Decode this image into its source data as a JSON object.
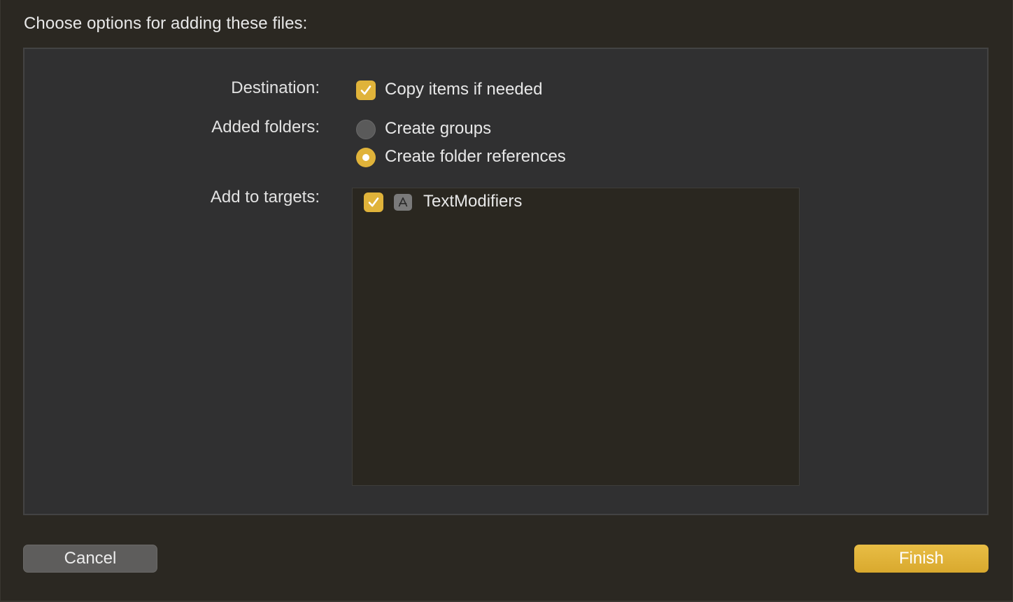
{
  "dialog": {
    "heading": "Choose options for adding these files:"
  },
  "options": {
    "destination": {
      "label": "Destination:",
      "checkbox_label": "Copy items if needed",
      "checked": true
    },
    "added_folders": {
      "label": "Added folders:",
      "choices": [
        {
          "label": "Create groups",
          "selected": false
        },
        {
          "label": "Create folder references",
          "selected": true
        }
      ]
    },
    "targets": {
      "label": "Add to targets:",
      "items": [
        {
          "name": "TextModifiers",
          "checked": true,
          "icon": "app-target-icon"
        }
      ]
    }
  },
  "buttons": {
    "cancel": "Cancel",
    "finish": "Finish"
  },
  "colors": {
    "accent": "#e0b33a",
    "background": "#2b2822",
    "panel": "#303031"
  }
}
